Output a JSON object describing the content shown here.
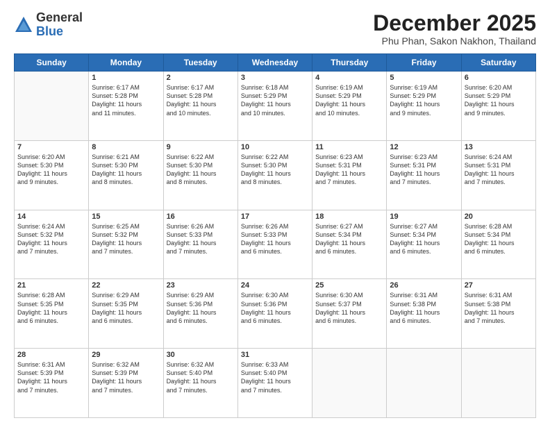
{
  "logo": {
    "general": "General",
    "blue": "Blue"
  },
  "title": "December 2025",
  "subtitle": "Phu Phan, Sakon Nakhon, Thailand",
  "days_of_week": [
    "Sunday",
    "Monday",
    "Tuesday",
    "Wednesday",
    "Thursday",
    "Friday",
    "Saturday"
  ],
  "weeks": [
    [
      {
        "day": "",
        "info": ""
      },
      {
        "day": "1",
        "info": "Sunrise: 6:17 AM\nSunset: 5:28 PM\nDaylight: 11 hours\nand 11 minutes."
      },
      {
        "day": "2",
        "info": "Sunrise: 6:17 AM\nSunset: 5:28 PM\nDaylight: 11 hours\nand 10 minutes."
      },
      {
        "day": "3",
        "info": "Sunrise: 6:18 AM\nSunset: 5:29 PM\nDaylight: 11 hours\nand 10 minutes."
      },
      {
        "day": "4",
        "info": "Sunrise: 6:19 AM\nSunset: 5:29 PM\nDaylight: 11 hours\nand 10 minutes."
      },
      {
        "day": "5",
        "info": "Sunrise: 6:19 AM\nSunset: 5:29 PM\nDaylight: 11 hours\nand 9 minutes."
      },
      {
        "day": "6",
        "info": "Sunrise: 6:20 AM\nSunset: 5:29 PM\nDaylight: 11 hours\nand 9 minutes."
      }
    ],
    [
      {
        "day": "7",
        "info": "Sunrise: 6:20 AM\nSunset: 5:30 PM\nDaylight: 11 hours\nand 9 minutes."
      },
      {
        "day": "8",
        "info": "Sunrise: 6:21 AM\nSunset: 5:30 PM\nDaylight: 11 hours\nand 8 minutes."
      },
      {
        "day": "9",
        "info": "Sunrise: 6:22 AM\nSunset: 5:30 PM\nDaylight: 11 hours\nand 8 minutes."
      },
      {
        "day": "10",
        "info": "Sunrise: 6:22 AM\nSunset: 5:30 PM\nDaylight: 11 hours\nand 8 minutes."
      },
      {
        "day": "11",
        "info": "Sunrise: 6:23 AM\nSunset: 5:31 PM\nDaylight: 11 hours\nand 7 minutes."
      },
      {
        "day": "12",
        "info": "Sunrise: 6:23 AM\nSunset: 5:31 PM\nDaylight: 11 hours\nand 7 minutes."
      },
      {
        "day": "13",
        "info": "Sunrise: 6:24 AM\nSunset: 5:31 PM\nDaylight: 11 hours\nand 7 minutes."
      }
    ],
    [
      {
        "day": "14",
        "info": "Sunrise: 6:24 AM\nSunset: 5:32 PM\nDaylight: 11 hours\nand 7 minutes."
      },
      {
        "day": "15",
        "info": "Sunrise: 6:25 AM\nSunset: 5:32 PM\nDaylight: 11 hours\nand 7 minutes."
      },
      {
        "day": "16",
        "info": "Sunrise: 6:26 AM\nSunset: 5:33 PM\nDaylight: 11 hours\nand 7 minutes."
      },
      {
        "day": "17",
        "info": "Sunrise: 6:26 AM\nSunset: 5:33 PM\nDaylight: 11 hours\nand 6 minutes."
      },
      {
        "day": "18",
        "info": "Sunrise: 6:27 AM\nSunset: 5:34 PM\nDaylight: 11 hours\nand 6 minutes."
      },
      {
        "day": "19",
        "info": "Sunrise: 6:27 AM\nSunset: 5:34 PM\nDaylight: 11 hours\nand 6 minutes."
      },
      {
        "day": "20",
        "info": "Sunrise: 6:28 AM\nSunset: 5:34 PM\nDaylight: 11 hours\nand 6 minutes."
      }
    ],
    [
      {
        "day": "21",
        "info": "Sunrise: 6:28 AM\nSunset: 5:35 PM\nDaylight: 11 hours\nand 6 minutes."
      },
      {
        "day": "22",
        "info": "Sunrise: 6:29 AM\nSunset: 5:35 PM\nDaylight: 11 hours\nand 6 minutes."
      },
      {
        "day": "23",
        "info": "Sunrise: 6:29 AM\nSunset: 5:36 PM\nDaylight: 11 hours\nand 6 minutes."
      },
      {
        "day": "24",
        "info": "Sunrise: 6:30 AM\nSunset: 5:36 PM\nDaylight: 11 hours\nand 6 minutes."
      },
      {
        "day": "25",
        "info": "Sunrise: 6:30 AM\nSunset: 5:37 PM\nDaylight: 11 hours\nand 6 minutes."
      },
      {
        "day": "26",
        "info": "Sunrise: 6:31 AM\nSunset: 5:38 PM\nDaylight: 11 hours\nand 6 minutes."
      },
      {
        "day": "27",
        "info": "Sunrise: 6:31 AM\nSunset: 5:38 PM\nDaylight: 11 hours\nand 7 minutes."
      }
    ],
    [
      {
        "day": "28",
        "info": "Sunrise: 6:31 AM\nSunset: 5:39 PM\nDaylight: 11 hours\nand 7 minutes."
      },
      {
        "day": "29",
        "info": "Sunrise: 6:32 AM\nSunset: 5:39 PM\nDaylight: 11 hours\nand 7 minutes."
      },
      {
        "day": "30",
        "info": "Sunrise: 6:32 AM\nSunset: 5:40 PM\nDaylight: 11 hours\nand 7 minutes."
      },
      {
        "day": "31",
        "info": "Sunrise: 6:33 AM\nSunset: 5:40 PM\nDaylight: 11 hours\nand 7 minutes."
      },
      {
        "day": "",
        "info": ""
      },
      {
        "day": "",
        "info": ""
      },
      {
        "day": "",
        "info": ""
      }
    ]
  ]
}
